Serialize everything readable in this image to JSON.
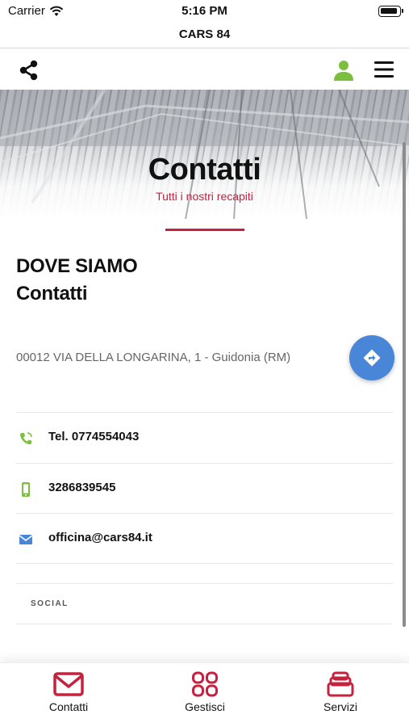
{
  "status_bar": {
    "carrier": "Carrier",
    "time": "5:16 PM"
  },
  "app": {
    "title": "CARS 84"
  },
  "toolbar": {
    "share_icon": "share-icon",
    "user_icon": "user-icon",
    "menu_icon": "menu-icon"
  },
  "hero": {
    "title": "Contatti",
    "subtitle": "Tutti i nostri recapiti"
  },
  "content": {
    "heading_line1": "DOVE SIAMO",
    "heading_line2": "Contatti",
    "address": "00012 VIA DELLA LONGARINA, 1 - Guidonia (RM)",
    "contacts": [
      {
        "icon": "phone-icon",
        "text": "Tel. 0774554043"
      },
      {
        "icon": "mobile-icon",
        "text": "3286839545"
      },
      {
        "icon": "mail-icon",
        "text": "officina@cars84.it"
      }
    ],
    "social_label": "SOCIAL"
  },
  "tabs": [
    {
      "label": "Contatti",
      "icon": "envelope-icon"
    },
    {
      "label": "Gestisci",
      "icon": "grid-icon"
    },
    {
      "label": "Servizi",
      "icon": "stack-icon"
    }
  ],
  "colors": {
    "accent": "#c4223f",
    "green": "#7cbf3f",
    "blue": "#4a86d8"
  }
}
